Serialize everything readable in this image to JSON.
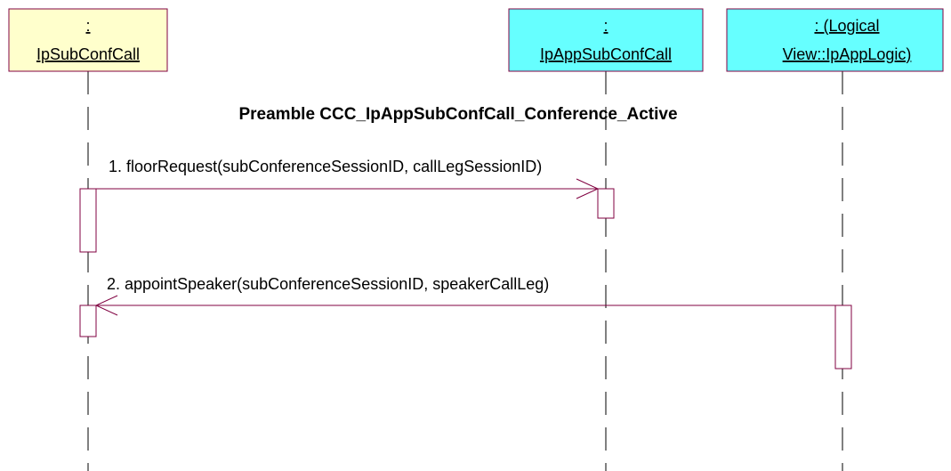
{
  "colors": {
    "participant_yellow": "#ffffcc",
    "participant_cyan": "#66ffff",
    "border": "#800040",
    "message_line": "#800040",
    "lifeline": "#000000"
  },
  "participants": [
    {
      "id": "IpSubConfCall",
      "line1": ":",
      "line2": "IpSubConfCall",
      "color": "yellow"
    },
    {
      "id": "IpAppSubConfCall",
      "line1": ":",
      "line2": "IpAppSubConfCall",
      "color": "cyan"
    },
    {
      "id": "IpAppLogic",
      "line1": ": (Logical",
      "line2": "View::IpAppLogic)",
      "color": "cyan"
    }
  ],
  "preamble": "Preamble CCC_IpAppSubConfCall_Conference_Active",
  "messages": [
    {
      "label": "1. floorRequest(subConferenceSessionID, callLegSessionID)",
      "from": "IpSubConfCall",
      "to": "IpAppSubConfCall"
    },
    {
      "label": "2. appointSpeaker(subConferenceSessionID, speakerCallLeg)",
      "from": "IpAppLogic",
      "to": "IpSubConfCall"
    }
  ]
}
